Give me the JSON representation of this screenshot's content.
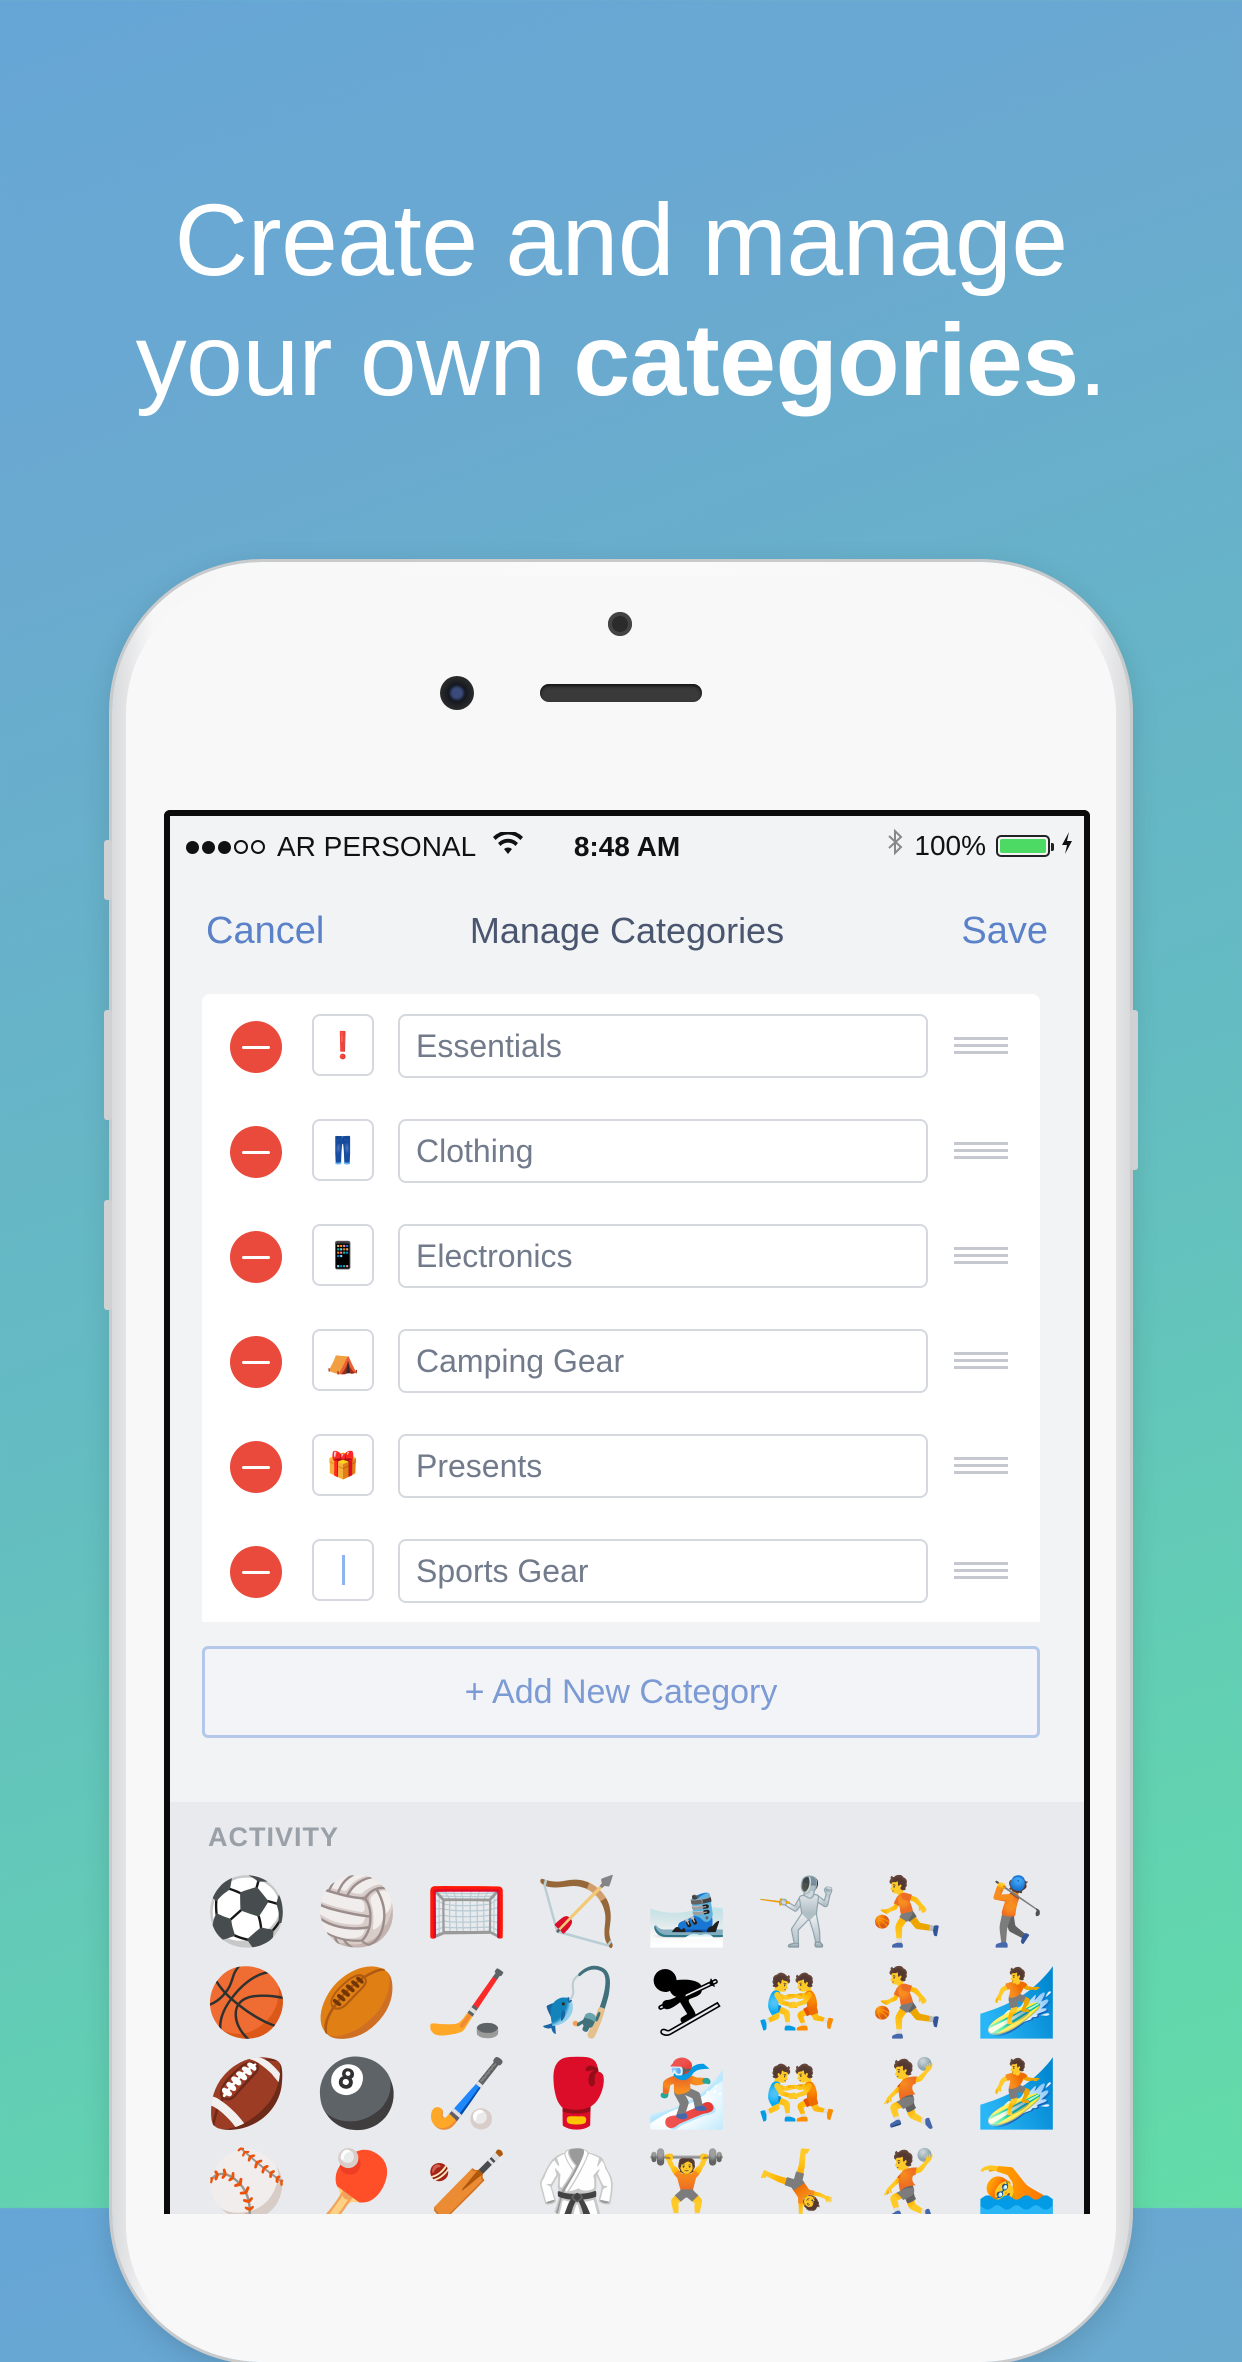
{
  "headline": {
    "line1": "Create and manage",
    "line2_prefix": "your own ",
    "line2_bold": "categories",
    "line2_suffix": "."
  },
  "status_bar": {
    "carrier": "AR PERSONAL",
    "time": "8:48 AM",
    "battery": "100%",
    "battery_level": 1.0,
    "signal_bars": 3
  },
  "nav": {
    "cancel_label": "Cancel",
    "title": "Manage Categories",
    "save_label": "Save"
  },
  "categories": [
    {
      "icon": "❗",
      "icon_name": "exclamation-icon",
      "name": "Essentials"
    },
    {
      "icon": "👖",
      "icon_name": "jeans-icon",
      "name": "Clothing"
    },
    {
      "icon": "📱",
      "icon_name": "phone-icon",
      "name": "Electronics"
    },
    {
      "icon": "⛺",
      "icon_name": "tent-icon",
      "name": "Camping Gear"
    },
    {
      "icon": "🎁",
      "icon_name": "gift-icon",
      "name": "Presents"
    },
    {
      "icon": "",
      "icon_name": "text-cursor",
      "name": "Sports Gear"
    }
  ],
  "add_button_label": "+ Add New Category",
  "emoji_panel": {
    "section_label": "ACTIVITY",
    "rows": [
      [
        "⚽",
        "🏐",
        "🥅",
        "🏹",
        "🎿",
        "🤺",
        "⛹",
        "🏌"
      ],
      [
        "🏀",
        "🏉",
        "🏒",
        "🎣",
        "⛷",
        "🤼",
        "⛹",
        "🏄"
      ],
      [
        "🏈",
        "🎱",
        "🏑",
        "🥊",
        "🏂",
        "🤼",
        "🤾",
        "🏄"
      ],
      [
        "⚾",
        "🏓",
        "🏏",
        "🥋",
        "🏋",
        "🤸",
        "🤾",
        "🏊"
      ]
    ]
  }
}
